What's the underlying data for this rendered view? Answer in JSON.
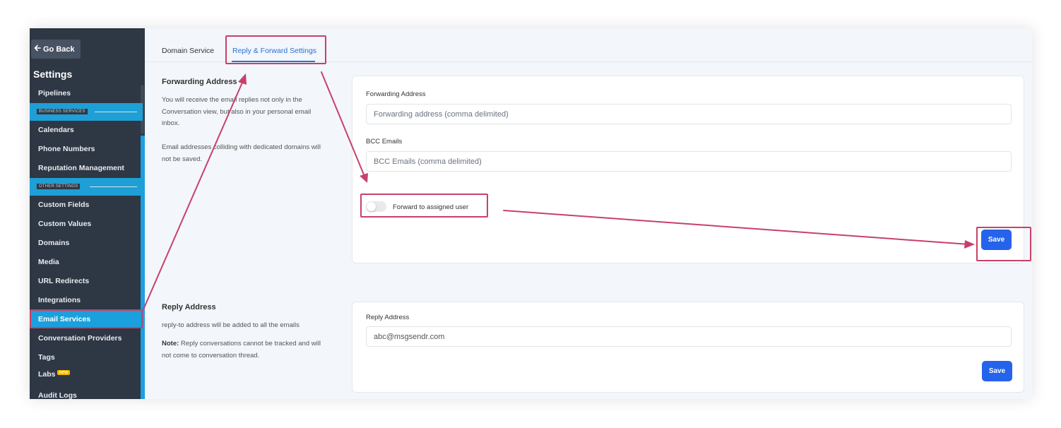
{
  "sidebar": {
    "go_back": "Go Back",
    "title": "Settings",
    "items": {
      "pipelines": "Pipelines",
      "calendars": "Calendars",
      "phone_numbers": "Phone Numbers",
      "reputation": "Reputation Management",
      "custom_fields": "Custom Fields",
      "custom_values": "Custom Values",
      "domains": "Domains",
      "media": "Media",
      "url_redirects": "URL Redirects",
      "integrations": "Integrations",
      "email_services": "Email Services",
      "conversation_providers": "Conversation Providers",
      "tags": "Tags",
      "labs": "Labs",
      "labs_badge": "new",
      "audit_logs": "Audit Logs"
    },
    "sections": {
      "business": "BUSINESS SERVICES",
      "other": "OTHER SETTINGS"
    }
  },
  "tabs": {
    "domain_service": "Domain Service",
    "reply_forward": "Reply & Forward Settings",
    "active": "reply_forward"
  },
  "forwarding": {
    "title": "Forwarding Address",
    "desc1": "You will receive the email replies not only in the Conversation view, but also in your personal email inbox.",
    "desc2": "Email addresses colliding with dedicated domains will not be saved.",
    "field_label": "Forwarding Address",
    "field_placeholder": "Forwarding address (comma delimited)",
    "bcc_label": "BCC Emails",
    "bcc_placeholder": "BCC Emails (comma delimited)",
    "toggle_label": "Forward to assigned user",
    "toggle_on": false,
    "save_label": "Save"
  },
  "reply": {
    "title": "Reply Address",
    "desc1": "reply-to address will be added to all the emails",
    "note_label": "Note:",
    "note_text": " Reply conversations cannot be tracked and will not come to conversation thread.",
    "field_label": "Reply Address",
    "field_value": "abc@msgsendr.com",
    "save_label": "Save"
  },
  "colors": {
    "sidebar_bg": "#2e3744",
    "accent": "#1aa0dc",
    "primary": "#2563eb",
    "highlight": "#c8406a"
  }
}
